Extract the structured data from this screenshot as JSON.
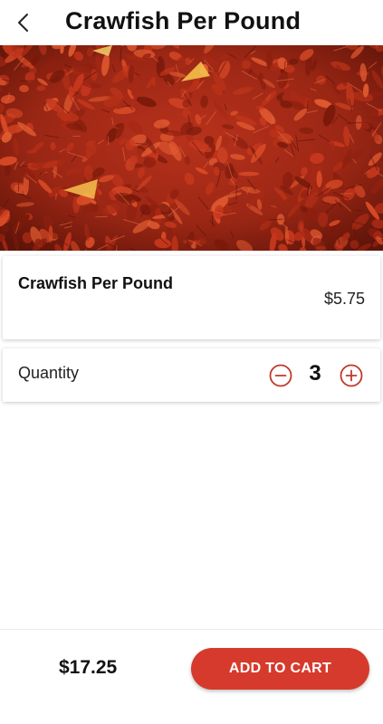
{
  "header": {
    "back_icon": "chevron-left-icon",
    "title": "Crawfish Per Pound"
  },
  "hero": {
    "image": "crawfish-photo"
  },
  "product": {
    "name": "Crawfish Per Pound",
    "price": "$5.75"
  },
  "quantity": {
    "label": "Quantity",
    "value": "3",
    "minus_icon": "minus-circle-icon",
    "plus_icon": "plus-circle-icon"
  },
  "footer": {
    "total": "$17.25",
    "add_to_cart_label": "ADD TO CART"
  },
  "colors": {
    "accent": "#d63a2c",
    "text": "#111111",
    "background": "#ffffff"
  }
}
